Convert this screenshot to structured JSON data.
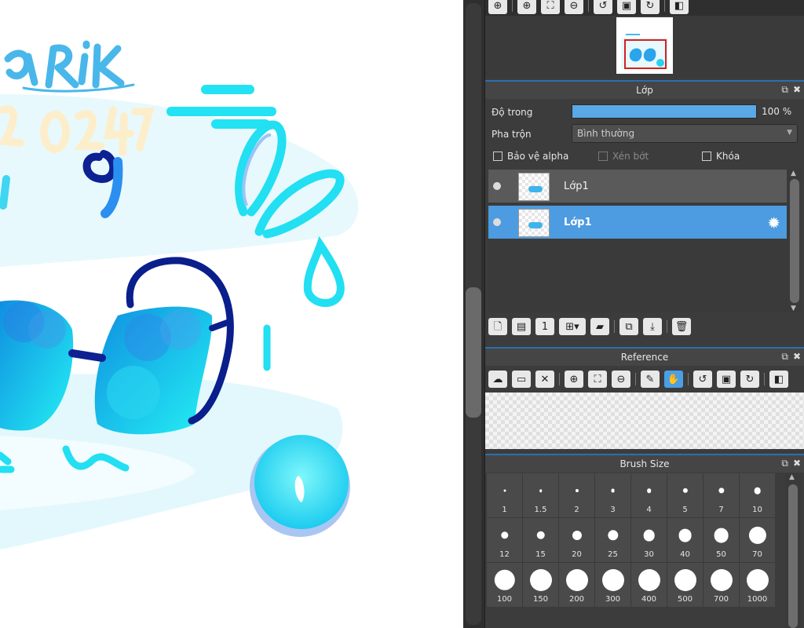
{
  "navigator": {
    "toolbar": [
      "zoom-fit-icon",
      "zoom-in-icon",
      "fit-window-icon",
      "zoom-out-icon",
      "rotate-left-icon",
      "rotate-reset-icon",
      "rotate-right-icon",
      "flip-horizontal-icon"
    ]
  },
  "layer_panel": {
    "title": "Lớp",
    "opacity_label": "Độ trong",
    "opacity_value": "100 %",
    "opacity_fraction": 1.0,
    "blend_label": "Pha trộn",
    "blend_value": "Bình thường",
    "protect_alpha_label": "Bảo vệ alpha",
    "clipping_label": "Xén bớt",
    "lock_label": "Khóa",
    "layers": [
      {
        "name": "Lớp1",
        "selected": false
      },
      {
        "name": "Lớp1",
        "selected": true
      }
    ],
    "bottom_toolbar": [
      "new-layer-icon",
      "new-halftone-layer-icon",
      "new-1bit-layer-icon",
      "add-layer-dropdown-icon",
      "new-folder-icon",
      "duplicate-layer-icon",
      "merge-down-icon",
      "delete-layer-icon"
    ]
  },
  "reference_panel": {
    "title": "Reference",
    "toolbar": [
      "load-cloud-icon",
      "open-file-icon",
      "close-icon",
      "zoom-in-icon",
      "fit-window-icon",
      "zoom-out-icon",
      "eyedropper-icon",
      "hand-icon",
      "rotate-left-icon",
      "rotate-reset-icon",
      "rotate-right-icon",
      "flip-horizontal-icon"
    ]
  },
  "brush_size_panel": {
    "title": "Brush Size",
    "sizes": [
      "1",
      "1.5",
      "2",
      "3",
      "4",
      "5",
      "7",
      "10",
      "12",
      "15",
      "20",
      "25",
      "30",
      "40",
      "50",
      "70",
      "100",
      "150",
      "200",
      "300",
      "400",
      "500",
      "700",
      "1000"
    ]
  },
  "colors": {
    "accent": "#4d9be0",
    "panel_bg": "#3c3c3c",
    "header_line": "#2b6fb0",
    "artwork_cyan": "#1fe3f3",
    "artwork_navy": "#0a1e8c"
  }
}
